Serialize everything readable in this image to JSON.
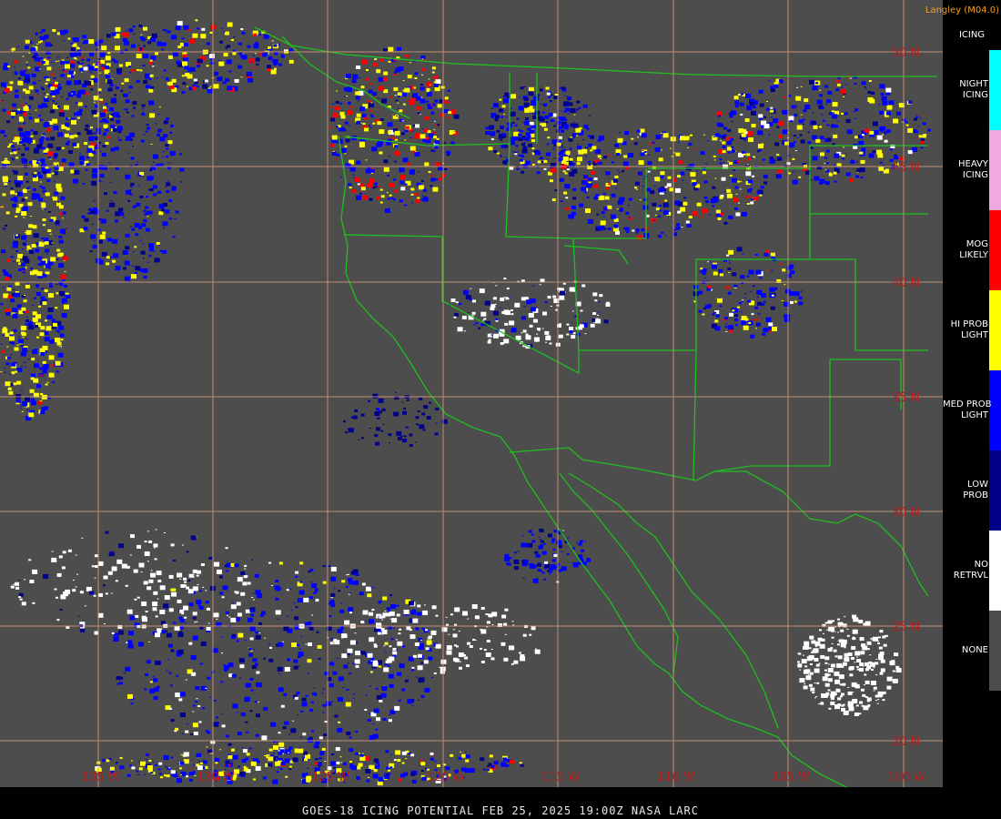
{
  "map": {
    "credit": "Langley (M04.0)",
    "footer": "GOES-18  ICING POTENTIAL   FEB 25, 2025 19:00Z   NASA LARC",
    "latitude_labels": [
      "50 N",
      "45 N",
      "40 N",
      "35 N",
      "30 N",
      "25 N",
      "20 N"
    ],
    "longitude_labels": [
      "135 W",
      "130 W",
      "125 W",
      "120 W",
      "115 W",
      "110 W",
      "105 W",
      "100 W"
    ],
    "colors": {
      "background": "#4d4d4d",
      "grid": "#d69a7a",
      "borders": "#1fbf1f",
      "label": "#b02020"
    }
  },
  "legend": {
    "title": "ICING",
    "items": [
      {
        "label": "NIGHT\nICING",
        "color": "#00ffff"
      },
      {
        "label": "HEAVY\nICING",
        "color": "#f0a8e0"
      },
      {
        "label": "MOG\nLIKELY",
        "color": "#ff0000"
      },
      {
        "label": "HI PROB\nLIGHT",
        "color": "#ffff00"
      },
      {
        "label": "MED PROB\nLIGHT",
        "color": "#0000ff"
      },
      {
        "label": "LOW\nPROB",
        "color": "#00008b"
      },
      {
        "label": "NO\nRETRVL",
        "color": "#ffffff"
      },
      {
        "label": "NONE",
        "color": "#4d4d4d"
      }
    ]
  }
}
